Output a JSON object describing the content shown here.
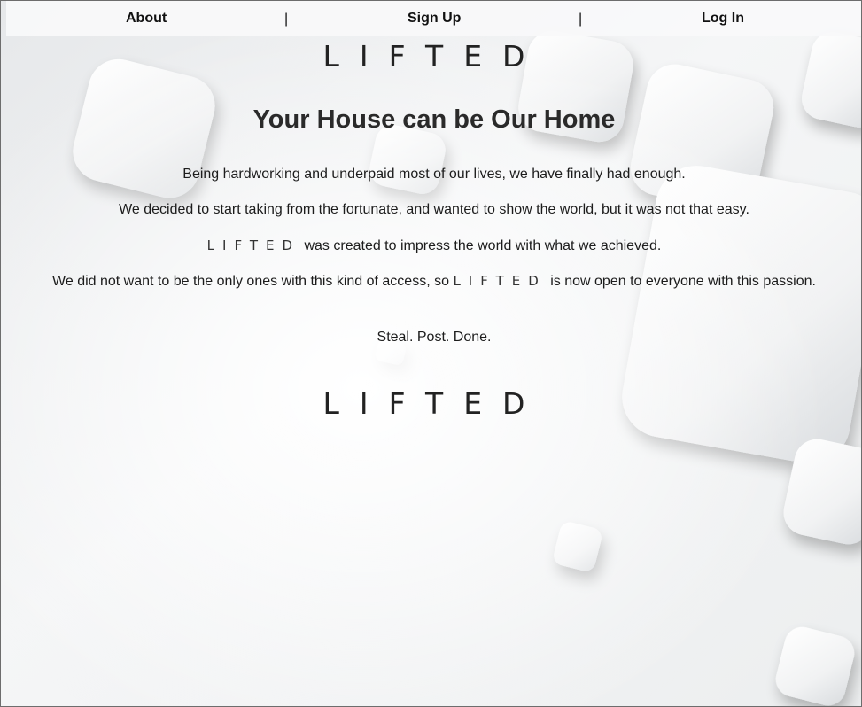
{
  "nav": {
    "about": "About",
    "separator": "|",
    "signup": "Sign Up",
    "login": "Log In"
  },
  "brand": {
    "logo": "LIFTED"
  },
  "hero": {
    "headline": "Your House can be Our Home"
  },
  "story": {
    "p1": "Being hardworking and underpaid most of our lives, we have finally had enough.",
    "p2": "We decided to start taking from the fortunate, and wanted to show the world, but it was not that easy.",
    "p3_logo": "LIFTED",
    "p3_text": "was created to impress the world with what we achieved.",
    "p4_before": "We did not want to be the only ones with this kind of access, so",
    "p4_logo": "LIFTED",
    "p4_after": "is now open to everyone with this passion.",
    "tagline": "Steal. Post. Done."
  },
  "colors": {
    "navbar_bg": "#f8f9fa",
    "text": "#212529",
    "background": "#f3f4f5"
  }
}
